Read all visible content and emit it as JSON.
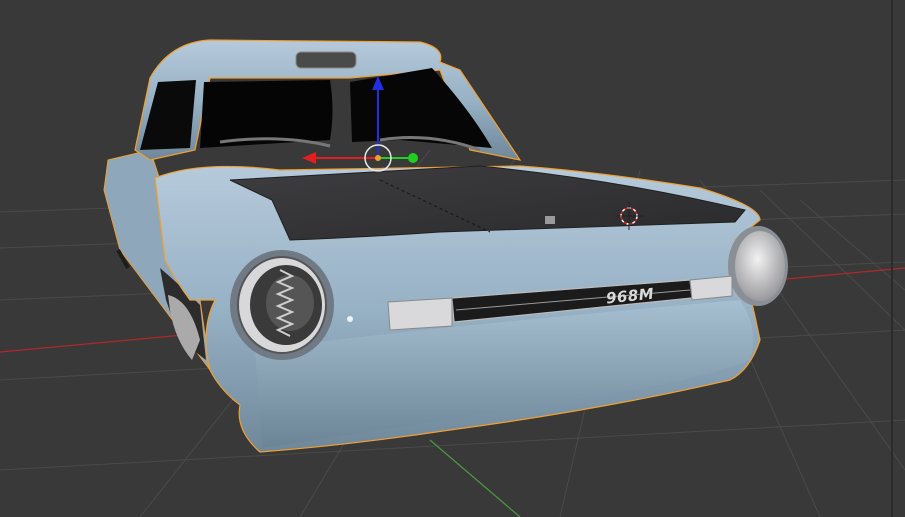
{
  "viewport": {
    "background": "#393939",
    "grid_color": "#4a4a4a",
    "x_axis_color": "#b0282a",
    "y_axis_color": "#4d9a43"
  },
  "model": {
    "badge_text": "968M",
    "body_color": "#97b1c5",
    "outline_color": "#f0a030"
  },
  "gizmo": {
    "type": "translate-manipulator",
    "x_color": "#e02020",
    "y_color": "#20d020",
    "z_color": "#2030e0"
  },
  "icons": {
    "cursor": "3d-cursor-icon",
    "origin": "object-origin-icon"
  }
}
